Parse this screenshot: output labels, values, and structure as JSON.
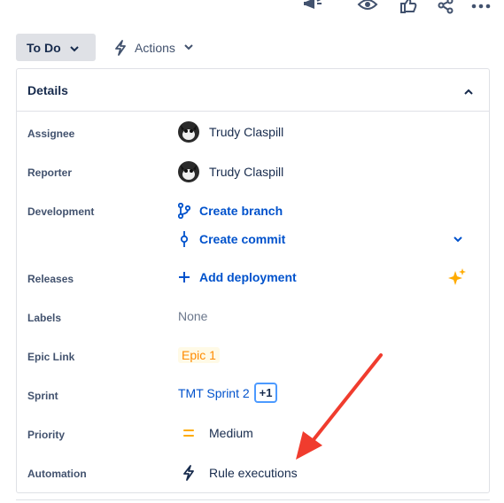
{
  "toolbar": {
    "icons": [
      "megaphone-icon",
      "eye-icon",
      "thumbs-up-icon",
      "share-icon",
      "more-icon"
    ],
    "status_label": "To Do",
    "actions_label": "Actions"
  },
  "details": {
    "title": "Details",
    "fields": {
      "assignee": {
        "label": "Assignee",
        "value": "Trudy Claspill"
      },
      "reporter": {
        "label": "Reporter",
        "value": "Trudy Claspill"
      },
      "development": {
        "label": "Development",
        "create_branch": "Create branch",
        "create_commit": "Create commit"
      },
      "releases": {
        "label": "Releases",
        "action": "Add deployment"
      },
      "labels": {
        "label": "Labels",
        "value": "None"
      },
      "epic_link": {
        "label": "Epic Link",
        "value": "Epic 1"
      },
      "sprint": {
        "label": "Sprint",
        "value": "TMT Sprint 2",
        "extra": "+1"
      },
      "priority": {
        "label": "Priority",
        "value": "Medium"
      },
      "automation": {
        "label": "Automation",
        "value": "Rule executions"
      }
    }
  },
  "colors": {
    "link": "#0052cc",
    "status_button_bg": "#dfe1e6",
    "epic_text": "#ff8b00",
    "priority": "#ffab00",
    "annotation_arrow": "#f03c2e"
  }
}
